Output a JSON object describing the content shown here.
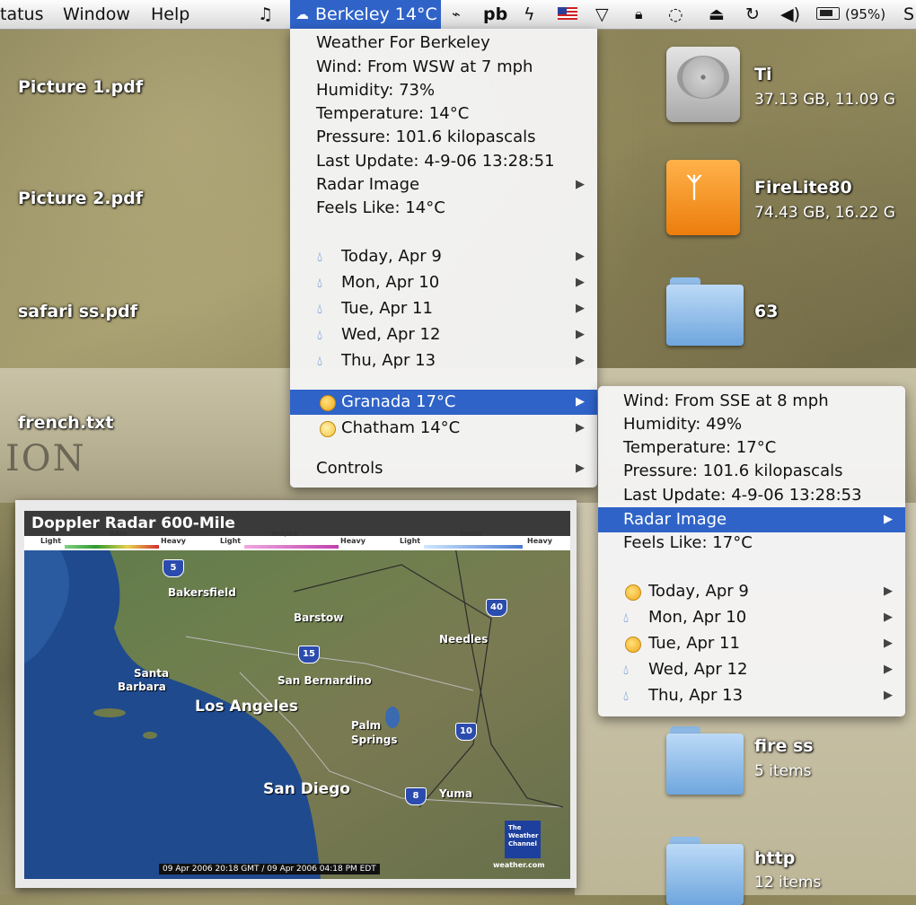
{
  "menubar": {
    "status_label": "tatus",
    "window_label": "Window",
    "help_label": "Help",
    "music_icon": "♫",
    "weather_title": "Berkeley 14°C",
    "pb_label": "pb",
    "battery_label": "(95%)",
    "s_label": "S"
  },
  "weather_menu": {
    "header": "Weather For Berkeley",
    "wind": "Wind: From WSW at 7 mph",
    "humidity": "Humidity: 73%",
    "temperature": "Temperature: 14°C",
    "pressure": "Pressure: 101.6 kilopascals",
    "last_update": "Last Update: 4-9-06 13:28:51",
    "radar": "Radar Image",
    "feels_like": "Feels Like: 14°C",
    "days": [
      "Today, Apr 9",
      "Mon, Apr 10",
      "Tue, Apr 11",
      "Wed, Apr 12",
      "Thu, Apr 13"
    ],
    "city_granada": "Granada 17°C",
    "city_chatham": "Chatham 14°C",
    "controls": "Controls"
  },
  "granada_menu": {
    "wind": "Wind: From SSE at 8 mph",
    "humidity": "Humidity: 49%",
    "temperature": "Temperature: 17°C",
    "pressure": "Pressure: 101.6 kilopascals",
    "last_update": "Last Update: 4-9-06 13:28:53",
    "radar": "Radar Image",
    "feels_like": "Feels Like: 17°C",
    "days": [
      "Today, Apr 9",
      "Mon, Apr 10",
      "Tue, Apr 11",
      "Wed, Apr 12",
      "Thu, Apr 13"
    ]
  },
  "desktop": {
    "files": [
      "Picture 1.pdf",
      "Picture 2.pdf",
      "safari ss.pdf",
      "french.txt"
    ],
    "ion_text": "ION",
    "volumes": [
      {
        "name": "Ti",
        "info": "37.13 GB, 11.09 G"
      },
      {
        "name": "FireLite80",
        "info": "74.43 GB, 16.22 G"
      }
    ],
    "folder_63": "63",
    "fire_ss": {
      "name": "fire ss",
      "info": "5 items"
    },
    "http": {
      "name": "http",
      "info": "12 items"
    }
  },
  "radar": {
    "title": "Doppler Radar 600-Mile",
    "legend": [
      "Light",
      "RAIN",
      "Heavy",
      "Light",
      "MIX/ICE",
      "Heavy",
      "Light",
      "SNOW",
      "Heavy"
    ],
    "cities": [
      "Bakersfield",
      "Barstow",
      "Needles",
      "Santa",
      "Barbara",
      "San Bernardino",
      "Los Angeles",
      "Palm",
      "Springs",
      "San Diego",
      "Yuma"
    ],
    "highways": [
      "5",
      "40",
      "15",
      "10",
      "8"
    ],
    "logo": [
      "The",
      "Weather",
      "Channel"
    ],
    "footer": "09 Apr 2006 20:18 GMT / 09 Apr 2006 04:18 PM EDT",
    "site": "weather.com"
  }
}
